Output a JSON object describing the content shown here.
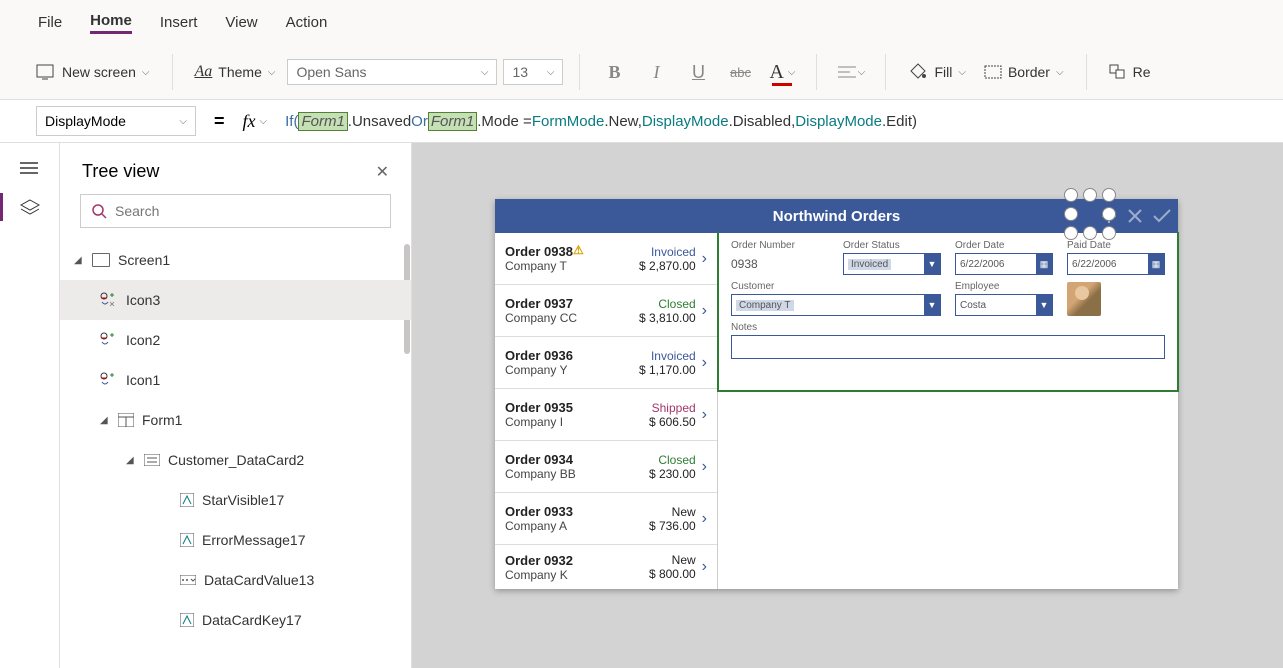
{
  "menu": {
    "file": "File",
    "home": "Home",
    "insert": "Insert",
    "view": "View",
    "action": "Action"
  },
  "ribbon": {
    "newScreen": "New screen",
    "theme": "Theme",
    "fontName": "Open Sans",
    "fontSize": "13",
    "fill": "Fill",
    "border": "Border",
    "re": "Re"
  },
  "formula": {
    "property": "DisplayMode",
    "tokens": {
      "if": "If(",
      "sp": " ",
      "form1a": "Form1",
      "unsaved": ".Unsaved ",
      "or": "Or",
      "form1b": "Form1",
      "mode": ".Mode = ",
      "formmode": "FormMode",
      "new": ".New, ",
      "dm1": "DisplayMode",
      "disabled": ".Disabled, ",
      "dm2": "DisplayMode",
      "edit": ".Edit ",
      "close": ")"
    }
  },
  "tree": {
    "title": "Tree view",
    "searchPlaceholder": "Search",
    "items": {
      "screen1": "Screen1",
      "icon3": "Icon3",
      "icon2": "Icon2",
      "icon1": "Icon1",
      "form1": "Form1",
      "customerCard": "Customer_DataCard2",
      "starVisible": "StarVisible17",
      "errorMessage": "ErrorMessage17",
      "dataCardValue": "DataCardValue13",
      "dataCardKey": "DataCardKey17"
    }
  },
  "app": {
    "title": "Northwind Orders",
    "orders": [
      {
        "num": "Order 0938",
        "co": "Company T",
        "status": "Invoiced",
        "statusCls": "st-invoiced",
        "amt": "$ 2,870.00",
        "warn": true
      },
      {
        "num": "Order 0937",
        "co": "Company CC",
        "status": "Closed",
        "statusCls": "st-closed",
        "amt": "$ 3,810.00"
      },
      {
        "num": "Order 0936",
        "co": "Company Y",
        "status": "Invoiced",
        "statusCls": "st-invoiced",
        "amt": "$ 1,170.00"
      },
      {
        "num": "Order 0935",
        "co": "Company I",
        "status": "Shipped",
        "statusCls": "st-shipped",
        "amt": "$ 606.50"
      },
      {
        "num": "Order 0934",
        "co": "Company BB",
        "status": "Closed",
        "statusCls": "st-closed",
        "amt": "$ 230.00"
      },
      {
        "num": "Order 0933",
        "co": "Company A",
        "status": "New",
        "statusCls": "st-new",
        "amt": "$ 736.00"
      },
      {
        "num": "Order 0932",
        "co": "Company K",
        "status": "New",
        "statusCls": "st-new",
        "amt": "$ 800.00"
      }
    ],
    "labels": {
      "orderNumber": "Order Number",
      "orderStatus": "Order Status",
      "orderDate": "Order Date",
      "paidDate": "Paid Date",
      "customer": "Customer",
      "employee": "Employee",
      "notes": "Notes"
    },
    "detail": {
      "orderNumber": "0938",
      "orderStatus": "Invoiced",
      "orderDate": "6/22/2006",
      "paidDate": "6/22/2006",
      "customer": "Company T",
      "employee": "Costa",
      "notes": ""
    }
  }
}
